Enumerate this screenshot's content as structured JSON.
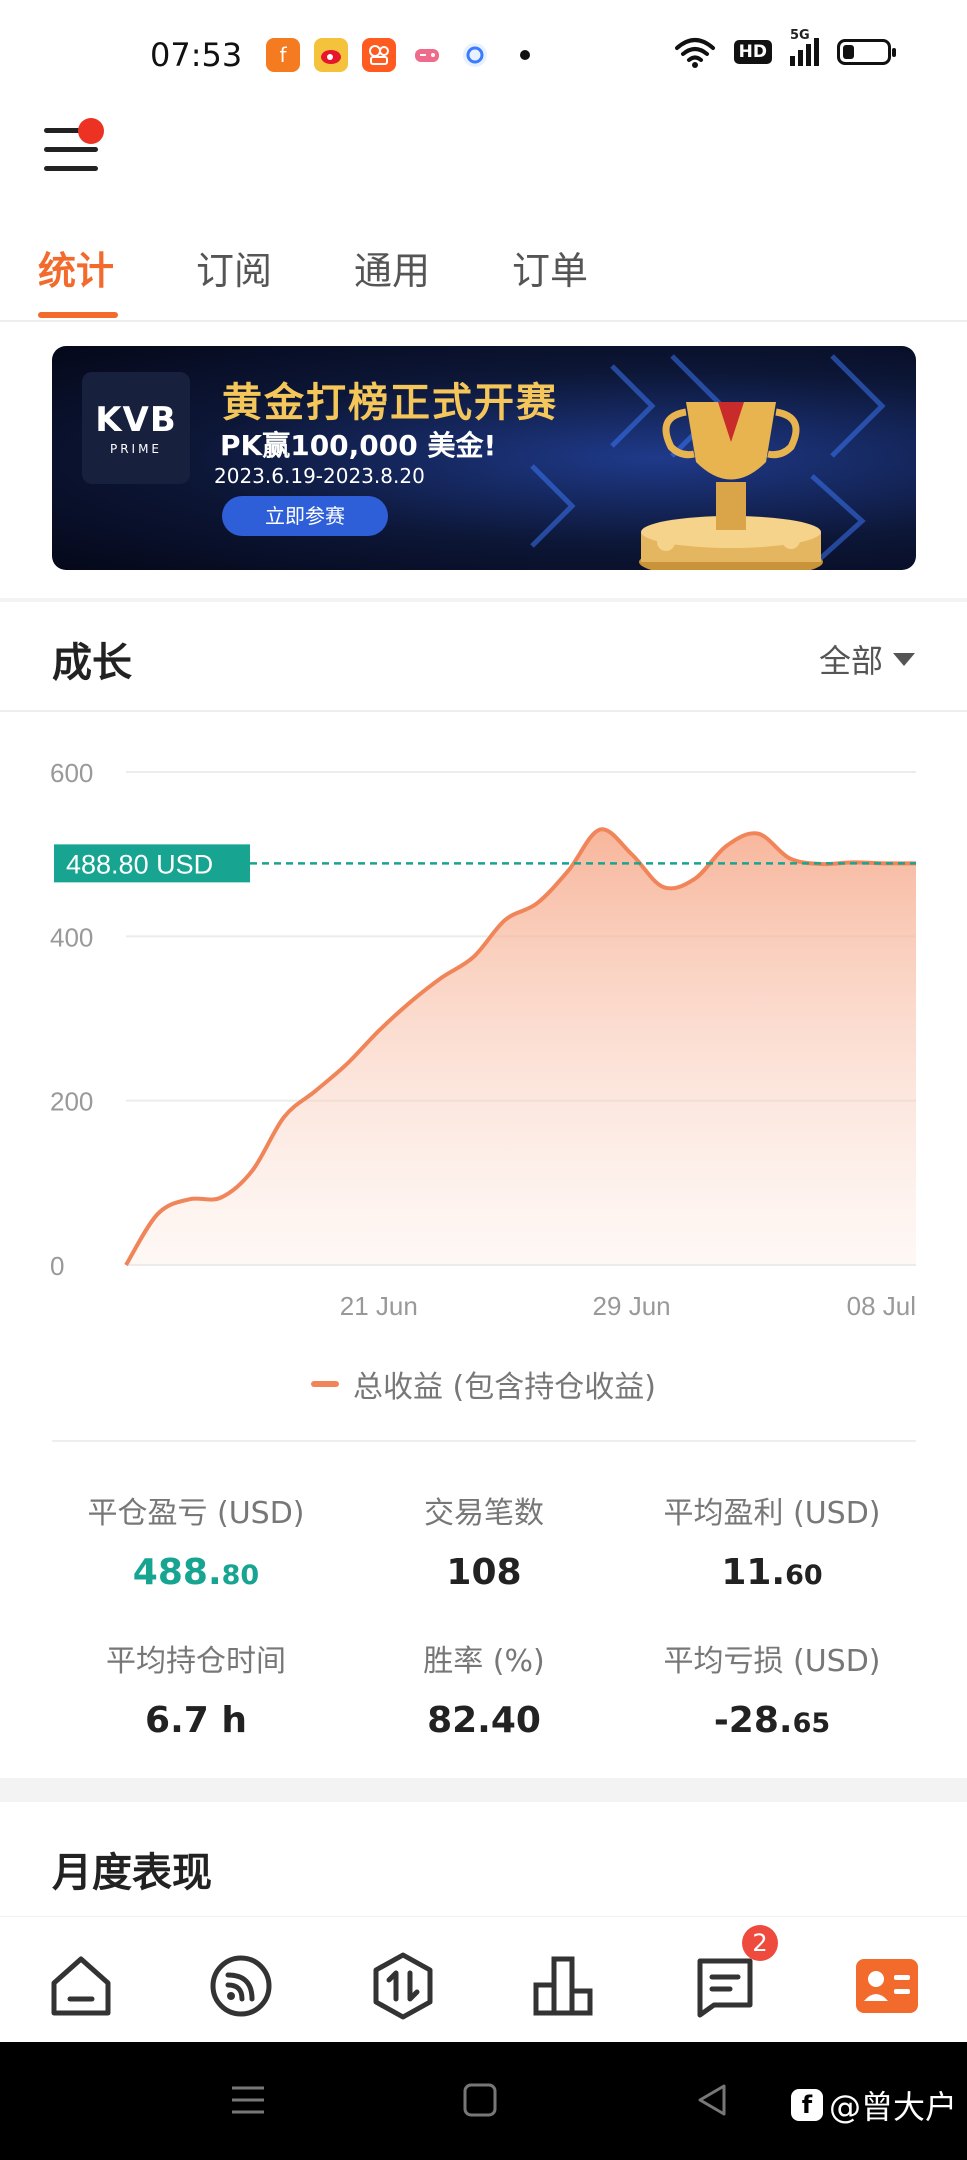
{
  "status_bar": {
    "time": "07:53",
    "network_label": "5G",
    "hd_label": "HD",
    "battery_level": 0.25
  },
  "tabs": [
    {
      "label": "统计",
      "active": true
    },
    {
      "label": "订阅",
      "active": false
    },
    {
      "label": "通用",
      "active": false
    },
    {
      "label": "订单",
      "active": false
    }
  ],
  "banner": {
    "logo_text": "KVB",
    "logo_sub": "PRIME",
    "title": "黄金打榜正式开赛",
    "subtitle": "PK赢100,000 美金!",
    "date_range": "2023.6.19-2023.8.20",
    "button_label": "立即参赛"
  },
  "growth": {
    "title": "成长",
    "filter_label": "全部"
  },
  "chart_data": {
    "type": "area",
    "y_ticks": [
      "600",
      "400",
      "200",
      "0"
    ],
    "ylim": [
      0,
      600
    ],
    "x_ticks": [
      "21 Jun",
      "29 Jun",
      "08 Jul"
    ],
    "current_value_label": "488.80 USD",
    "current_value": 488.8,
    "grid": true,
    "legend_position": "bottom",
    "series": [
      {
        "name": "总收益 (包含持仓收益)",
        "color": "#f08559",
        "x": [
          "2023-06-13",
          "2023-06-14",
          "2023-06-15",
          "2023-06-16",
          "2023-06-17",
          "2023-06-18",
          "2023-06-19",
          "2023-06-20",
          "2023-06-21",
          "2023-06-22",
          "2023-06-23",
          "2023-06-24",
          "2023-06-25",
          "2023-06-26",
          "2023-06-27",
          "2023-06-28",
          "2023-06-29",
          "2023-06-30",
          "2023-07-01",
          "2023-07-02",
          "2023-07-03",
          "2023-07-04",
          "2023-07-05",
          "2023-07-06",
          "2023-07-07",
          "2023-07-08"
        ],
        "values": [
          0,
          62,
          80,
          82,
          115,
          180,
          212,
          245,
          285,
          320,
          350,
          375,
          420,
          440,
          480,
          530,
          500,
          460,
          470,
          510,
          525,
          495,
          488,
          490,
          488.8,
          488.8
        ]
      }
    ]
  },
  "stats": [
    {
      "label": "平仓盈亏 (USD)",
      "int": "488.",
      "frac": "80",
      "highlight": true
    },
    {
      "label": "交易笔数",
      "int": "108",
      "frac": "",
      "highlight": false
    },
    {
      "label": "平均盈利 (USD)",
      "int": "11.",
      "frac": "60",
      "highlight": false
    },
    {
      "label": "平均持仓时间",
      "int": "6.7 h",
      "frac": "",
      "highlight": false
    },
    {
      "label": "胜率 (%)",
      "int": "82.40",
      "frac": "",
      "highlight": false
    },
    {
      "label": "平均亏损 (USD)",
      "int": "-28.",
      "frac": "65",
      "highlight": false
    }
  ],
  "monthly": {
    "title": "月度表现"
  },
  "bottom_nav": {
    "items": [
      {
        "name": "home-icon",
        "active": false
      },
      {
        "name": "feed-icon",
        "active": false
      },
      {
        "name": "trade-icon",
        "active": false
      },
      {
        "name": "ranking-icon",
        "active": false
      },
      {
        "name": "message-icon",
        "active": false,
        "badge": "2"
      },
      {
        "name": "profile-card-icon",
        "active": true
      }
    ],
    "accent_color": "#f26b2d"
  },
  "watermark": "@曾大户"
}
